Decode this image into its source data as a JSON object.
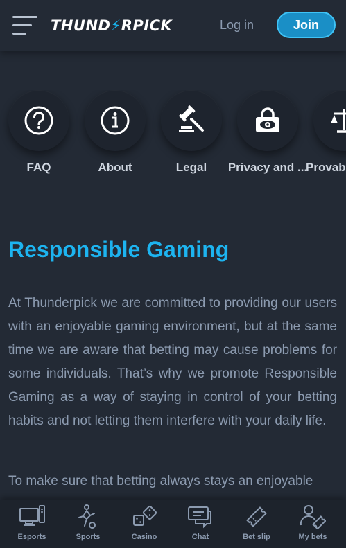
{
  "header": {
    "logo_left": "THUND",
    "logo_bolt": "⚡",
    "logo_right": "RPICK",
    "login_label": "Log in",
    "join_label": "Join"
  },
  "quick_links": [
    {
      "label": "FAQ",
      "icon": "question-icon"
    },
    {
      "label": "About",
      "icon": "info-icon"
    },
    {
      "label": "Legal",
      "icon": "gavel-icon"
    },
    {
      "label": "Privacy and ...",
      "icon": "privacy-lock-icon"
    },
    {
      "label": "Provab",
      "icon": "scale-icon"
    }
  ],
  "main": {
    "title": "Responsible Gaming",
    "paragraph1": "At Thunderpick we are committed to providing our users with an enjoyable gaming environment, but at the same time we are aware that betting may cause problems for some individuals. That’s why we promote Responsible Gaming as a way of staying in control of your betting habits and not letting them interfere with your daily life.",
    "paragraph2": "To make sure that betting always stays an enjoyable"
  },
  "bottom_nav": [
    {
      "label": "Esports",
      "icon": "esports-icon"
    },
    {
      "label": "Sports",
      "icon": "sports-icon"
    },
    {
      "label": "Casino",
      "icon": "casino-dice-icon"
    },
    {
      "label": "Chat",
      "icon": "chat-icon"
    },
    {
      "label": "Bet slip",
      "icon": "bet-slip-icon"
    },
    {
      "label": "My bets",
      "icon": "my-bets-icon"
    }
  ],
  "colors": {
    "background": "#232a35",
    "accent": "#1db4f0",
    "join_button": "#1a8fc6",
    "text_muted": "#8c9bb0"
  }
}
